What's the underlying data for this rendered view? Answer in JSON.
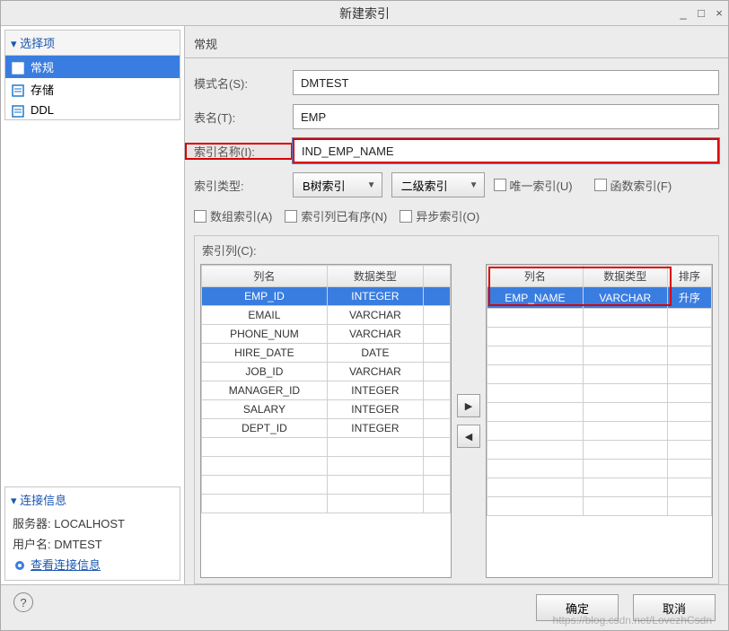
{
  "window": {
    "title": "新建索引"
  },
  "sidebar": {
    "section": "选择项",
    "items": [
      {
        "label": "常规",
        "icon": "form-icon",
        "selected": true
      },
      {
        "label": "存储",
        "icon": "form-icon",
        "selected": false
      },
      {
        "label": "DDL",
        "icon": "form-icon",
        "selected": false
      }
    ]
  },
  "connection": {
    "title": "连接信息",
    "server_label": "服务器:",
    "server_value": "LOCALHOST",
    "user_label": "用户名:",
    "user_value": "DMTEST",
    "link_label": "查看连接信息"
  },
  "tab": {
    "title": "常规"
  },
  "form": {
    "schema_label": "模式名(S):",
    "schema_value": "DMTEST",
    "table_label": "表名(T):",
    "table_value": "EMP",
    "index_name_label": "索引名称(I):",
    "index_name_value": "IND_EMP_NAME",
    "index_type_label": "索引类型:",
    "index_type_value": "B树索引",
    "secondary_value": "二级索引",
    "unique_label": "唯一索引(U)",
    "func_label": "函数索引(F)",
    "array_label": "数组索引(A)",
    "ordered_label": "索引列已有序(N)",
    "async_label": "异步索引(O)"
  },
  "columns": {
    "caption": "索引列(C):",
    "left": {
      "headers": [
        "列名",
        "数据类型"
      ],
      "rows": [
        {
          "name": "EMP_ID",
          "type": "INTEGER",
          "selected": true
        },
        {
          "name": "EMAIL",
          "type": "VARCHAR",
          "selected": false
        },
        {
          "name": "PHONE_NUM",
          "type": "VARCHAR",
          "selected": false
        },
        {
          "name": "HIRE_DATE",
          "type": "DATE",
          "selected": false
        },
        {
          "name": "JOB_ID",
          "type": "VARCHAR",
          "selected": false
        },
        {
          "name": "MANAGER_ID",
          "type": "INTEGER",
          "selected": false
        },
        {
          "name": "SALARY",
          "type": "INTEGER",
          "selected": false
        },
        {
          "name": "DEPT_ID",
          "type": "INTEGER",
          "selected": false
        }
      ]
    },
    "right": {
      "headers": [
        "列名",
        "数据类型",
        "排序"
      ],
      "rows": [
        {
          "name": "EMP_NAME",
          "type": "VARCHAR",
          "order": "升序",
          "selected": true
        }
      ]
    }
  },
  "footer": {
    "ok": "确定",
    "cancel": "取消"
  },
  "watermark": "https://blog.csdn.net/LovezhCsdn"
}
